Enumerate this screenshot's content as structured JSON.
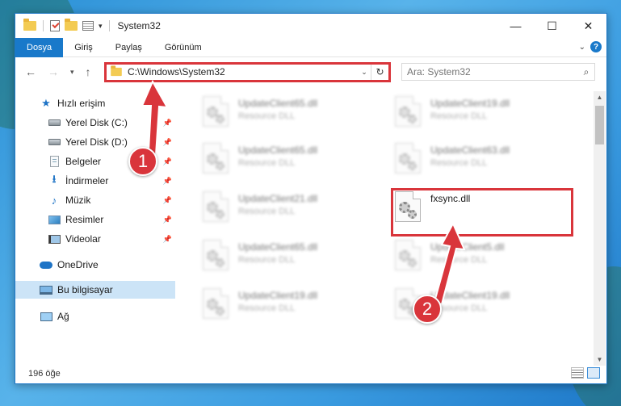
{
  "window": {
    "title": "System32",
    "controls": {
      "minimize": "—",
      "maximize": "☐",
      "close": "✕"
    }
  },
  "ribbon": {
    "tabs": [
      {
        "label": "Dosya",
        "active": true
      },
      {
        "label": "Giriş"
      },
      {
        "label": "Paylaş"
      },
      {
        "label": "Görünüm"
      }
    ],
    "help": "?"
  },
  "address": {
    "path": "C:\\Windows\\System32",
    "search_placeholder": "Ara: System32"
  },
  "sidebar": {
    "items": [
      {
        "label": "Hızlı erişim",
        "icon": "star-icon"
      },
      {
        "label": "Yerel Disk (C:)",
        "icon": "disk-icon",
        "pinned": true
      },
      {
        "label": "Yerel Disk (D:)",
        "icon": "disk-icon",
        "pinned": true
      },
      {
        "label": "Belgeler",
        "icon": "document-icon",
        "pinned": true
      },
      {
        "label": "İndirmeler",
        "icon": "download-icon",
        "pinned": true
      },
      {
        "label": "Müzik",
        "icon": "music-icon",
        "pinned": true
      },
      {
        "label": "Resimler",
        "icon": "pictures-icon",
        "pinned": true
      },
      {
        "label": "Videolar",
        "icon": "video-icon",
        "pinned": true
      },
      {
        "label": "OneDrive",
        "icon": "cloud-icon"
      },
      {
        "label": "Bu bilgisayar",
        "icon": "computer-icon",
        "selected": true
      },
      {
        "label": "Ağ",
        "icon": "network-icon"
      }
    ]
  },
  "files": [
    {
      "name": "UpdateClient65.dll",
      "desc": "Resource DLL",
      "blurred": true
    },
    {
      "name": "UpdateClient19.dll",
      "desc": "Resource DLL",
      "blurred": true
    },
    {
      "name": "UpdateClient65.dll",
      "desc": "Resource DLL",
      "blurred": true
    },
    {
      "name": "UpdateClient63.dll",
      "desc": "Resource DLL",
      "blurred": true
    },
    {
      "name": "UpdateClient21.dll",
      "desc": "Resource DLL",
      "blurred": true
    },
    {
      "name": "fxsync.dll",
      "desc": "",
      "blurred": false
    },
    {
      "name": "UpdateClient65.dll",
      "desc": "Resource DLL",
      "blurred": true
    },
    {
      "name": "UpdateClient5.dll",
      "desc": "Resource DLL",
      "blurred": true
    },
    {
      "name": "UpdateClient19.dll",
      "desc": "Resource DLL",
      "blurred": true
    },
    {
      "name": "UpdateClient19.dll",
      "desc": "Resource DLL",
      "blurred": true
    }
  ],
  "status": {
    "item_count": "196 öğe"
  },
  "annotations": {
    "step1": "1",
    "step2": "2",
    "color": "#d9353b"
  }
}
